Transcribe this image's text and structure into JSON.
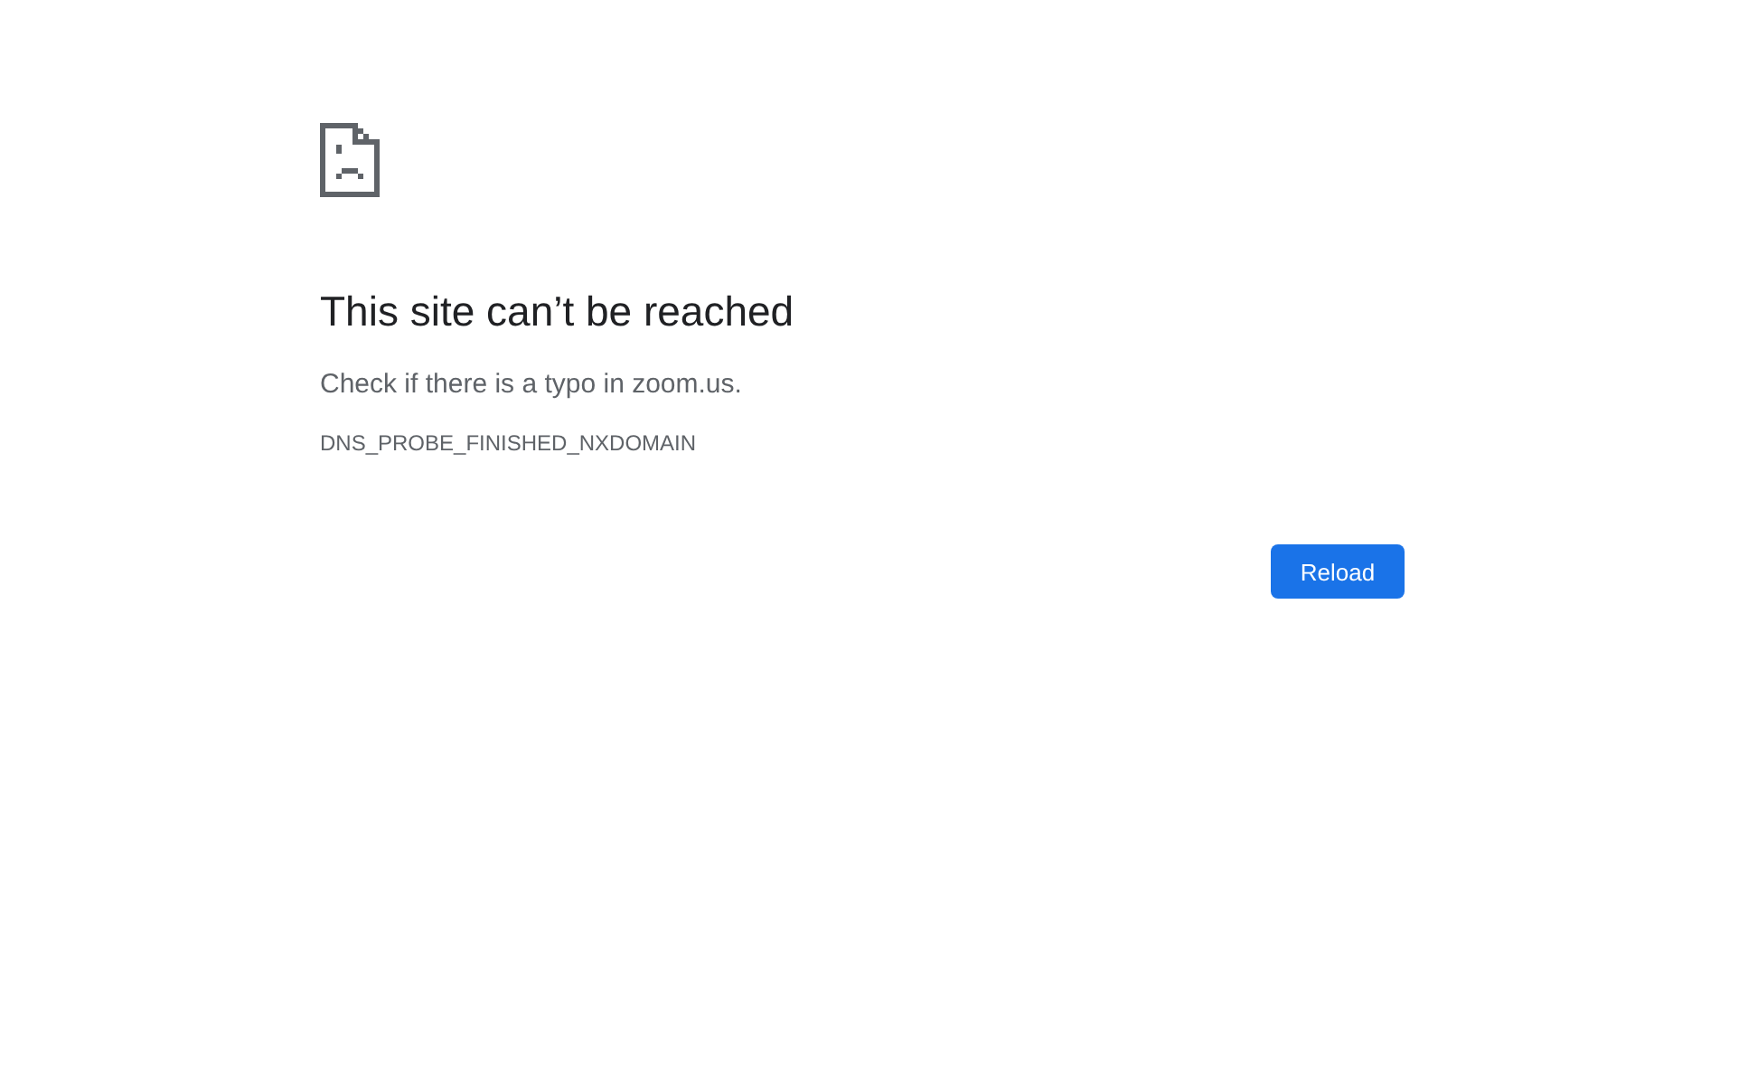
{
  "heading": "This site can’t be reached",
  "message": "Check if there is a typo in zoom.us.",
  "error_code": "DNS_PROBE_FINISHED_NXDOMAIN",
  "buttons": [
    {
      "label": "Reload"
    }
  ]
}
